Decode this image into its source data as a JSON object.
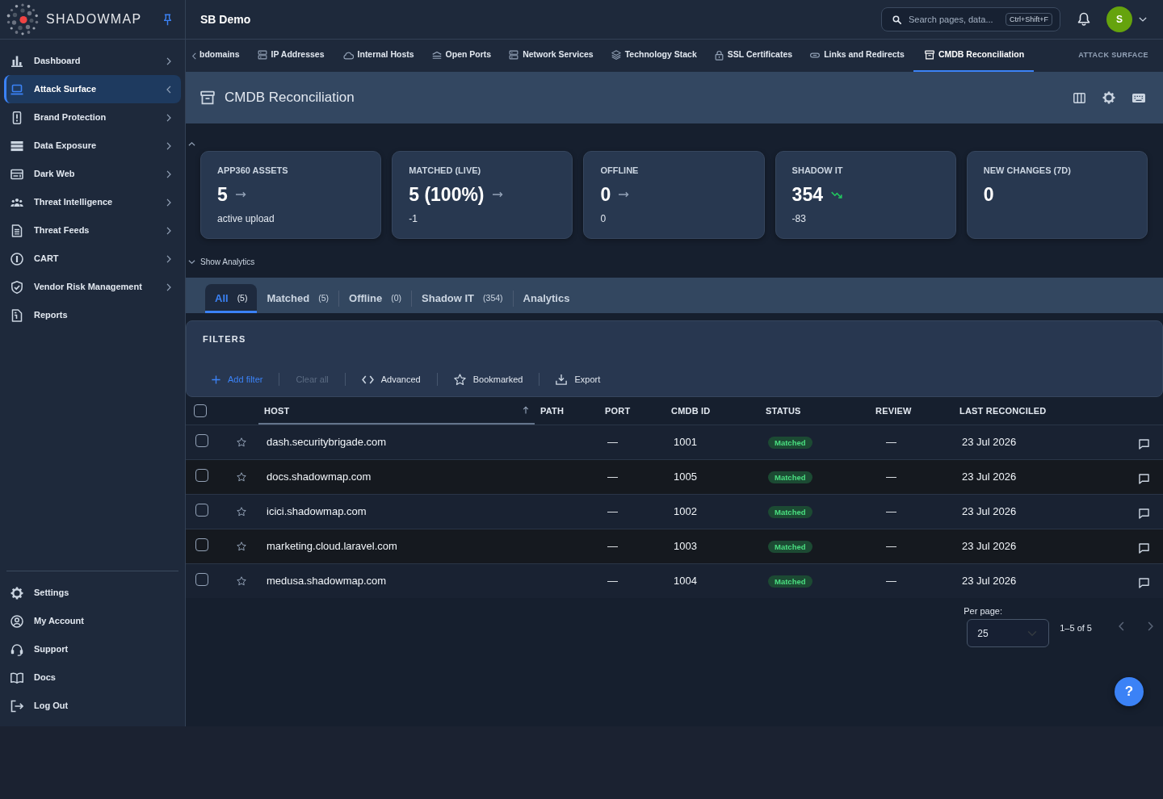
{
  "sidebar": {
    "brand": "SHADOWMAP",
    "items": [
      {
        "label": "Dashboard",
        "kind": "menu",
        "selected": false
      },
      {
        "label": "Attack Surface",
        "kind": "menu",
        "selected": true
      },
      {
        "label": "Brand Protection",
        "kind": "menu",
        "selected": false
      },
      {
        "label": "Data Exposure",
        "kind": "menu",
        "selected": false
      },
      {
        "label": "Dark Web",
        "kind": "menu",
        "selected": false
      },
      {
        "label": "Threat Intelligence",
        "kind": "menu",
        "selected": false
      },
      {
        "label": "Threat Feeds",
        "kind": "menu",
        "selected": false
      },
      {
        "label": "CART",
        "kind": "menu",
        "selected": false
      },
      {
        "label": "Vendor Risk Management",
        "kind": "menu",
        "selected": false
      },
      {
        "label": "Reports",
        "kind": "link",
        "selected": false
      }
    ],
    "footer_items": [
      {
        "label": "Settings"
      },
      {
        "label": "My Account"
      },
      {
        "label": "Support"
      },
      {
        "label": "Docs"
      },
      {
        "label": "Log Out"
      }
    ]
  },
  "topbar": {
    "workspace": "SB Demo",
    "search": {
      "placeholder": "Search pages, data...",
      "shortcut": "Ctrl+Shift+F"
    },
    "avatar_initial": "S"
  },
  "subnav": {
    "items": [
      {
        "label": "bdomains",
        "selected": false
      },
      {
        "label": "IP Addresses",
        "selected": false
      },
      {
        "label": "Internal Hosts",
        "selected": false
      },
      {
        "label": "Open Ports",
        "selected": false
      },
      {
        "label": "Network Services",
        "selected": false
      },
      {
        "label": "Technology Stack",
        "selected": false
      },
      {
        "label": "SSL Certificates",
        "selected": false
      },
      {
        "label": "Links and Redirects",
        "selected": false
      },
      {
        "label": "CMDB Reconciliation",
        "selected": true
      }
    ],
    "section": "ATTACK SURFACE"
  },
  "page": {
    "title": "CMDB Reconciliation"
  },
  "stats": [
    {
      "label": "APP360 ASSETS",
      "value": "5",
      "kind": "flat",
      "note": "active upload"
    },
    {
      "label": "MATCHED (LIVE)",
      "value": "5 (100%)",
      "kind": "flat",
      "note": "-1"
    },
    {
      "label": "OFFLINE",
      "value": "0",
      "kind": "flat",
      "note": "0"
    },
    {
      "label": "SHADOW IT",
      "value": "354",
      "kind": "down",
      "note": "-83"
    },
    {
      "label": "NEW CHANGES (7D)",
      "value": "0",
      "kind": "plain"
    }
  ],
  "analytics_toggle": "Show Analytics",
  "tabs": [
    {
      "label": "All",
      "count": "(5)",
      "selected": true
    },
    {
      "label": "Matched",
      "count": "(5)",
      "selected": false
    },
    {
      "label": "Offline",
      "count": "(0)",
      "selected": false
    },
    {
      "label": "Shadow IT",
      "count": "(354)",
      "selected": false
    },
    {
      "label": "Analytics",
      "selected": false
    }
  ],
  "filters": {
    "title": "FILTERS",
    "actions": [
      {
        "label": "Add filter",
        "primary": true,
        "disabled": false
      },
      {
        "label": "Clear all",
        "primary": false,
        "disabled": true
      },
      {
        "label": "Advanced",
        "primary": false,
        "disabled": false
      },
      {
        "label": "Bookmarked",
        "primary": false,
        "disabled": false
      },
      {
        "label": "Export",
        "primary": false,
        "disabled": false
      }
    ]
  },
  "table": {
    "select_all": false,
    "columns": [
      {
        "label": "HOST",
        "sorted": true
      },
      {
        "label": "PATH",
        "sorted": false
      },
      {
        "label": "PORT",
        "sorted": false
      },
      {
        "label": "CMDB ID",
        "sorted": false
      },
      {
        "label": "STATUS",
        "sorted": false
      },
      {
        "label": "REVIEW",
        "sorted": false
      },
      {
        "label": "LAST RECONCILED",
        "sorted": false
      }
    ],
    "rows": [
      {
        "checked": false,
        "starred": false,
        "host": "dash.securitybrigade.com",
        "port": "—",
        "cmdb_id": "1001",
        "status": "Matched",
        "review": "—",
        "last_reconciled": "23 Jul 2026"
      },
      {
        "checked": false,
        "starred": false,
        "host": "docs.shadowmap.com",
        "port": "—",
        "cmdb_id": "1005",
        "status": "Matched",
        "review": "—",
        "last_reconciled": "23 Jul 2026"
      },
      {
        "checked": false,
        "starred": false,
        "host": "icici.shadowmap.com",
        "port": "—",
        "cmdb_id": "1002",
        "status": "Matched",
        "review": "—",
        "last_reconciled": "23 Jul 2026"
      },
      {
        "checked": false,
        "starred": false,
        "host": "marketing.cloud.laravel.com",
        "port": "—",
        "cmdb_id": "1003",
        "status": "Matched",
        "review": "—",
        "last_reconciled": "23 Jul 2026"
      },
      {
        "checked": false,
        "starred": false,
        "host": "medusa.shadowmap.com",
        "port": "—",
        "cmdb_id": "1004",
        "status": "Matched",
        "review": "—",
        "last_reconciled": "23 Jul 2026"
      }
    ]
  },
  "pagination": {
    "per_page_label": "Per page:",
    "per_page": "25",
    "range": "1–5 of 5",
    "prev_disabled": true,
    "next_disabled": true
  },
  "help_button": "?"
}
